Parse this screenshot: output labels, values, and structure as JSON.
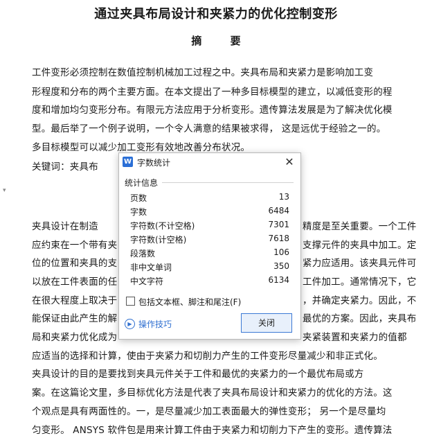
{
  "document": {
    "title": "通过夹具布局设计和夹紧力的优化控制变形",
    "abstract_heading": "摘  要",
    "lines": [
      "        工件变形必须控制在数值控制机械加工过程之中。夹具布局和夹紧力是影响加工变",
      "形程度和分布的两个主要方面。在本文提出了一种多目标模型的建立，以减低变形的程",
      "度和增加均匀变形分布。有限元方法应用于分析变形。遗传算法发展是为了解决优化模",
      "型。最后举了一个例子说明，一个令人满意的结果被求得，  这是远优于经验之一的。",
      "多目标模型可以减少加工变形有效地改善分布状况。",
      "        关键词：夹具布",
      "        夹具设计在制造",
      "应约束在一个带有夹",
      "位的位置和夹具的支",
      "以放在工件表面的任",
      "在很大程度上取决于",
      "能保证由此产生的解",
      "局和夹紧力优化成为",
      "应适当的选择和计算，使由于夹紧力和切削力产生的工件变形尽量减少和非正式化。",
      "        夹具设计的目的是要找到夹具元件关于工件和最优的夹紧力的一个最优布局或方",
      "案。在这篇论文里，多目标优化方法是代表了夹具布局设计和夹紧力的优化的方法。这",
      "个观点是具有两面性的。一，是尽量减少加工表面最大的弹性变形；  另一个是尽量均",
      "匀变形。 ANSYS 软件包是用来计算工件由于夹紧力和切削力下产生的变形。遗传算法"
    ],
    "right_fragments": [
      "精度是至关重要。一个工件",
      "支撑元件的夹具中加工。定",
      "紧力应适用。该夹具元件可",
      "工件加工。通常情况下，它",
      "，并确定夹紧力。因此，不",
      "最优的方案。因此，夹具布",
      "夹紧装置和夹紧力的值都"
    ]
  },
  "dialog": {
    "title": "字数统计",
    "app_icon": "W",
    "section_label": "统计信息",
    "stats": [
      {
        "label": "页数",
        "value": "13"
      },
      {
        "label": "字数",
        "value": "6484"
      },
      {
        "label": "字符数(不计空格)",
        "value": "7301"
      },
      {
        "label": "字符数(计空格)",
        "value": "7618"
      },
      {
        "label": "段落数",
        "value": "106"
      },
      {
        "label": "非中文单词",
        "value": "350"
      },
      {
        "label": "中文字符",
        "value": "6134"
      }
    ],
    "checkbox_label": "包括文本框、脚注和尾注(F)",
    "checkbox_checked": false,
    "tips_label": "操作技巧",
    "close_button": "关闭",
    "close_icon": "close-icon",
    "accent_color": "#2b6fd6"
  }
}
